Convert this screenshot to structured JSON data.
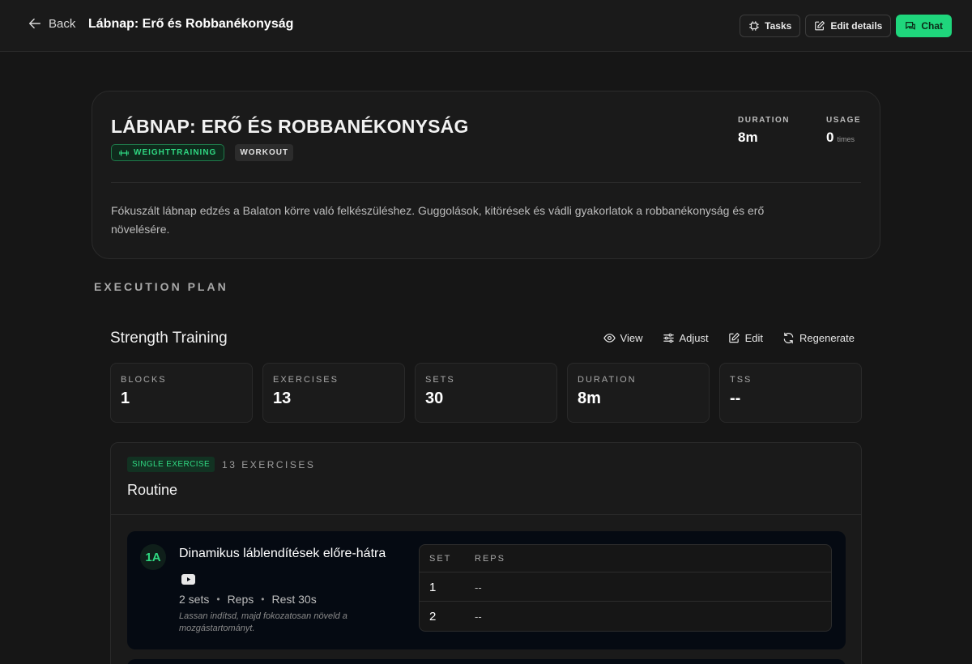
{
  "nav": {
    "back_label": "Back",
    "title": "Lábnap: Erő és Robbanékonyság",
    "actions": {
      "tasks": "Tasks",
      "edit_details": "Edit details",
      "chat": "Chat"
    }
  },
  "workout": {
    "title": "LÁBNAP: ERŐ ÉS ROBBANÉKONYSÁG",
    "badges": {
      "category": "WEIGHTTRAINING",
      "type": "WORKOUT"
    },
    "meta": {
      "duration_label": "DURATION",
      "duration_value": "8m",
      "usage_label": "USAGE",
      "usage_value": "0",
      "usage_unit": "times"
    },
    "description": "Fókuszált lábnap edzés a Balaton körre való felkészüléshez. Guggolások, kitörések és vádli gyakorlatok a robbanékonyság és erő növelésére."
  },
  "execution_plan": {
    "section_label": "EXECUTION PLAN",
    "title": "Strength Training",
    "actions": {
      "view": "View",
      "adjust": "Adjust",
      "edit": "Edit",
      "regenerate": "Regenerate"
    },
    "stats": [
      {
        "label": "BLOCKS",
        "value": "1"
      },
      {
        "label": "EXERCISES",
        "value": "13"
      },
      {
        "label": "SETS",
        "value": "30"
      },
      {
        "label": "DURATION",
        "value": "8m"
      },
      {
        "label": "TSS",
        "value": "--"
      }
    ],
    "block": {
      "tag": "SINGLE EXERCISE",
      "count": "13 EXERCISES",
      "title": "Routine",
      "exercise": {
        "number": "1A",
        "name": "Dinamikus láblendítések előre-hátra",
        "sets": "2 sets",
        "reps": "Reps",
        "rest": "Rest 30s",
        "note": "Lassan indítsd, majd fokozatosan növeld a mozgástartományt.",
        "table_headers": {
          "set": "SET",
          "reps": "REPS"
        },
        "rows": [
          {
            "set": "1",
            "reps": "--"
          },
          {
            "set": "2",
            "reps": "--"
          }
        ]
      }
    }
  },
  "colors": {
    "accent": "#1fd67c",
    "background": "#161616",
    "card": "#1a1a1a"
  }
}
